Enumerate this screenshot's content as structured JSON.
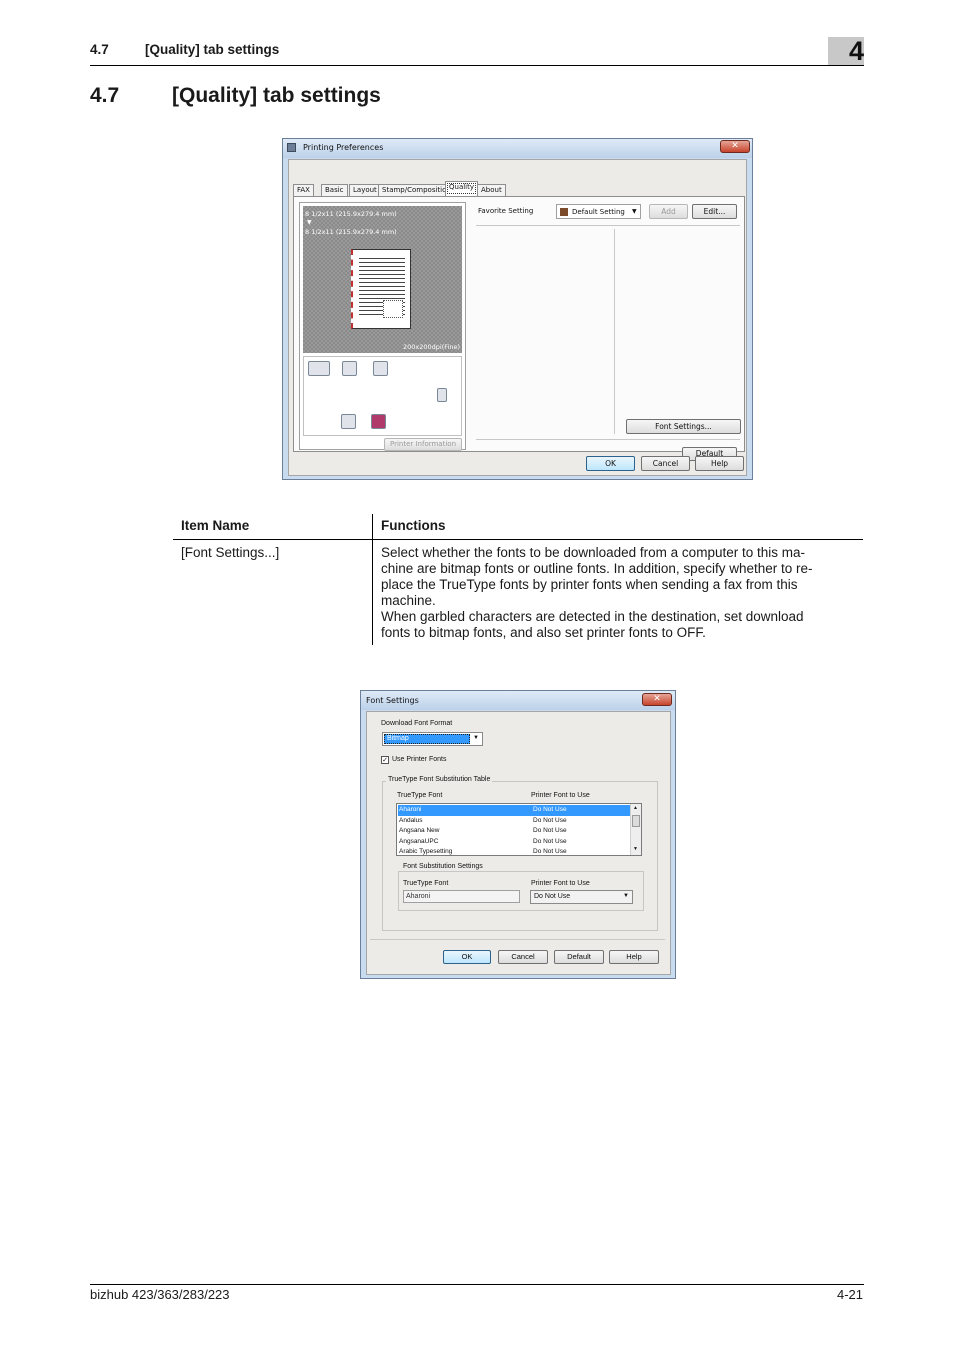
{
  "header": {
    "section_number": "4.7",
    "section_title": "[Quality] tab settings",
    "chapter": "4"
  },
  "title": {
    "number": "4.7",
    "text": "[Quality] tab settings"
  },
  "printing_preferences": {
    "window_title": "Printing Preferences",
    "close_glyph": "✕",
    "tabs": [
      "FAX",
      "Basic",
      "Layout",
      "Stamp/Composition",
      "Quality",
      "About"
    ],
    "paper_line1": "8 1/2x11 (215.9x279.4 mm)",
    "arrow": "▼",
    "paper_line2": "8 1/2x11 (215.9x279.4 mm)",
    "resolution": "200x200dpi(Fine)",
    "printer_info_button": "Printer Information",
    "favorite_label": "Favorite Setting",
    "favorite_value": "Default Setting",
    "add_button": "Add",
    "edit_button": "Edit...",
    "font_settings_button": "Font Settings...",
    "default_button": "Default",
    "ok_button": "OK",
    "cancel_button": "Cancel",
    "help_button": "Help"
  },
  "table": {
    "header_item": "Item Name",
    "header_functions": "Functions",
    "rows": [
      {
        "item": "[Font Settings...]",
        "lines": [
          "Select whether the fonts to be downloaded from a computer to this ma-",
          "chine are bitmap fonts or outline fonts. In addition, specify whether to re-",
          "place the TrueType fonts by printer fonts when sending a fax from this",
          "machine.",
          "When garbled characters are detected in the destination, set download",
          "fonts to bitmap fonts, and also set printer fonts to OFF."
        ]
      }
    ]
  },
  "font_settings": {
    "window_title": "Font Settings",
    "close_glyph": "✕",
    "download_format_label": "Download Font Format",
    "download_format_value": "Bitmap",
    "use_printer_fonts_label": "Use Printer Fonts",
    "use_printer_fonts_checked": true,
    "substitution_table_label": "TrueType Font Substitution Table",
    "col_truetype": "TrueType Font",
    "col_printer": "Printer Font to Use",
    "rows": [
      {
        "font": "Aharoni",
        "printer": "Do Not Use"
      },
      {
        "font": "Andalus",
        "printer": "Do Not Use"
      },
      {
        "font": "Angsana New",
        "printer": "Do Not Use"
      },
      {
        "font": "AngsanaUPC",
        "printer": "Do Not Use"
      },
      {
        "font": "Arabic Typesetting",
        "printer": "Do Not Use"
      }
    ],
    "substitution_settings_label": "Font Substitution Settings",
    "sub_truetype_label": "TrueType Font",
    "sub_truetype_value": "Aharoni",
    "sub_printer_label": "Printer Font to Use",
    "sub_printer_value": "Do Not Use",
    "ok_button": "OK",
    "cancel_button": "Cancel",
    "default_button": "Default",
    "help_button": "Help"
  },
  "footer": {
    "product": "bizhub 423/363/283/223",
    "page": "4-21"
  }
}
